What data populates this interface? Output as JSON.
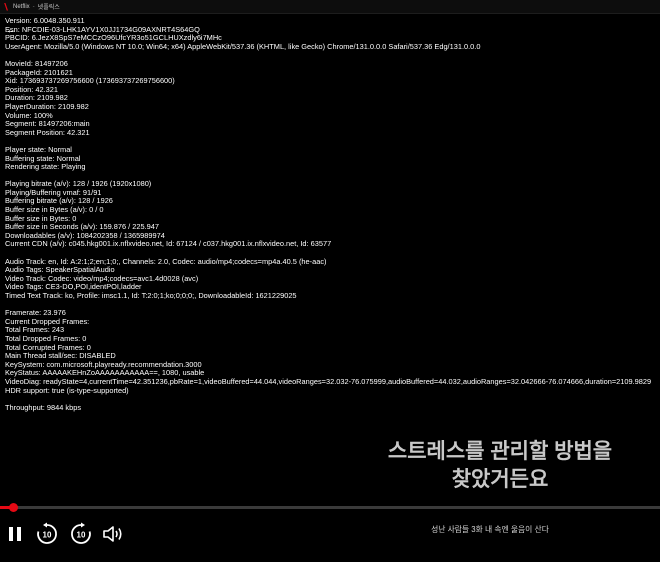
{
  "window": {
    "app_name": "Netflix",
    "title": "넷플릭스"
  },
  "debug_lines": [
    "Version: 6.0048.350.911",
    "Esn: NFCDIE-03-LHK1AYV1X0JJ1734G09AXNRT4S64GQ",
    "PBCID: 6.JezX8SpS7eMCCzO96UfcYR3o51GCLHUXzdly6i7MHc",
    "UserAgent: Mozilla/5.0 (Windows NT 10.0; Win64; x64) AppleWebKit/537.36 (KHTML, like Gecko) Chrome/131.0.0.0 Safari/537.36 Edg/131.0.0.0",
    "",
    "MovieId: 81497206",
    "PackageId: 2101621",
    "Xid: 173693737269756600 (173693737269756600)",
    "Position: 42.321",
    "Duration: 2109.982",
    "PlayerDuration: 2109.982",
    "Volume: 100%",
    "Segment: 81497206:main",
    "Segment Position: 42.321",
    "",
    "Player state: Normal",
    "Buffering state: Normal",
    "Rendering state: Playing",
    "",
    "Playing bitrate (a/v): 128 / 1926 (1920x1080)",
    "Playing/Buffering vmaf: 91/91",
    "Buffering bitrate (a/v): 128 / 1926",
    "Buffer size in Bytes (a/v): 0 / 0",
    "Buffer size in Bytes: 0",
    "Buffer size in Seconds (a/v): 159.876 / 225.947",
    "Downloadables (a/v): 1084202358 / 1365989974",
    "Current CDN (a/v): c045.hkg001.ix.nflxvideo.net, Id: 67124 / c037.hkg001.ix.nflxvideo.net, Id: 63577",
    "",
    "Audio Track: en, Id: A:2:1;2;en;1;0;, Channels: 2.0, Codec: audio/mp4;codecs=mp4a.40.5 (he-aac)",
    "Audio Tags: SpeakerSpatialAudio",
    "Video Track: Codec: video/mp4;codecs=avc1.4d0028 (avc)",
    "Video Tags: CE3-DO,POI,identPOI,ladder",
    "Timed Text Track: ko, Profile: imsc1.1, Id: T:2:0;1;ko;0;0;0;, DownloadableId: 1621229025",
    "",
    "Framerate: 23.976",
    "Current Dropped Frames:",
    "Total Frames: 243",
    "Total Dropped Frames: 0",
    "Total Corrupted Frames: 0",
    "Main Thread stall/sec: DISABLED",
    "KeySystem: com.microsoft.playready.recommendation.3000",
    "KeyStatus: AAAAAKEHnZoAAAAAAAAAAA==, 1080, usable",
    "VideoDiag: readyState=4,currentTime=42.351236,pbRate=1,videoBuffered=44.044,videoRanges=32.032-76.075999,audioBuffered=44.032,audioRanges=32.042666-76.074666,duration=2109.9829",
    "HDR support: true (is-type-supported)",
    "",
    "Throughput: 9844 kbps"
  ],
  "subtitle": {
    "line1": "스트레스를 관리할 방법을",
    "line2": "찾았거든요"
  },
  "playback": {
    "progress_fraction": 0.02
  },
  "controls": {
    "rewind_seconds": "10",
    "forward_seconds": "10"
  },
  "episode_title": "성난 사람들 3화  내 속엔 울음이 산다",
  "colors": {
    "accent": "#e50914",
    "background": "#000000"
  }
}
